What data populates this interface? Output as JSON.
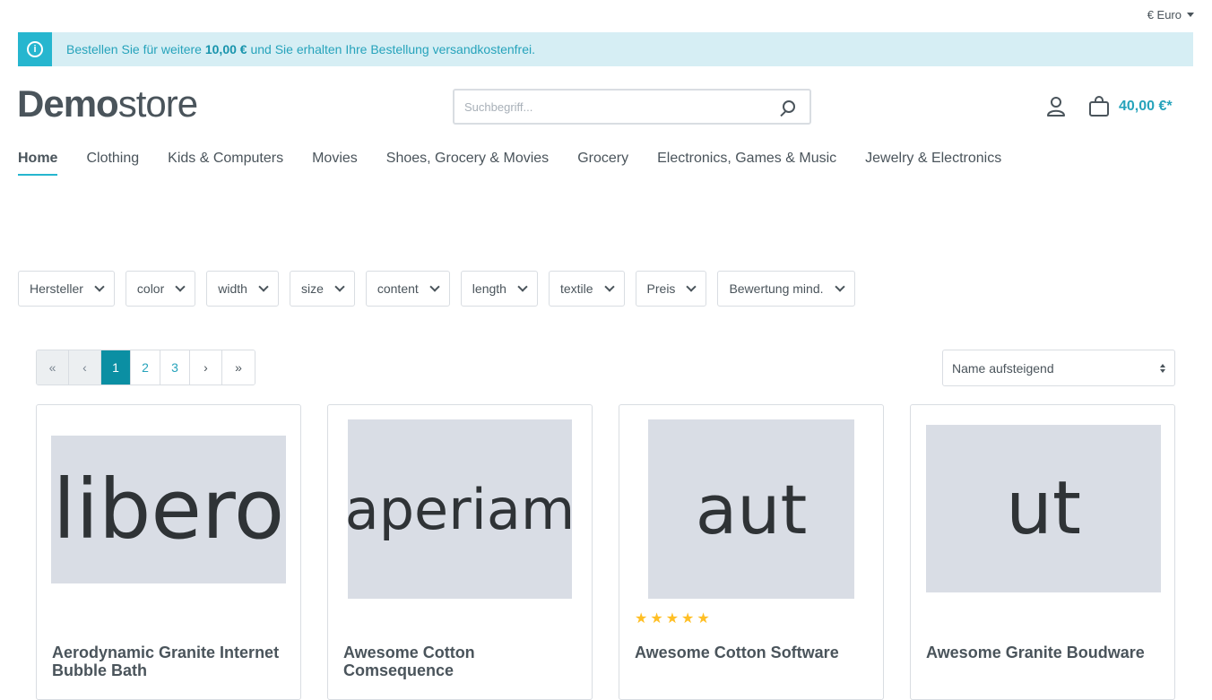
{
  "currency": {
    "label": "€ Euro"
  },
  "banner": {
    "text_before": "Bestellen Sie für weitere ",
    "amount": "10,00 €",
    "text_after": " und Sie erhalten Ihre Bestellung versandkostenfrei."
  },
  "header": {
    "logo_bold": "Demo",
    "logo_rest": "store",
    "search_placeholder": "Suchbegriff...",
    "cart_total": "40,00 €*"
  },
  "nav": {
    "items": [
      {
        "label": "Home"
      },
      {
        "label": "Clothing"
      },
      {
        "label": "Kids & Computers"
      },
      {
        "label": "Movies"
      },
      {
        "label": "Shoes, Grocery & Movies"
      },
      {
        "label": "Grocery"
      },
      {
        "label": "Electronics, Games & Music"
      },
      {
        "label": "Jewelry & Electronics"
      }
    ]
  },
  "filters": [
    {
      "label": "Hersteller"
    },
    {
      "label": "color"
    },
    {
      "label": "width"
    },
    {
      "label": "size"
    },
    {
      "label": "content"
    },
    {
      "label": "length"
    },
    {
      "label": "textile"
    },
    {
      "label": "Preis"
    },
    {
      "label": "Bewertung mind."
    }
  ],
  "pagination": {
    "first": "«",
    "prev": "‹",
    "pages": [
      "1",
      "2",
      "3"
    ],
    "current": "1",
    "next": "›",
    "last": "»"
  },
  "sort": {
    "selected": "Name aufsteigend"
  },
  "products": [
    {
      "image_text": "libero",
      "name": "Aerodynamic Granite Internet Bubble Bath",
      "rating": 0
    },
    {
      "image_text": "aperiam",
      "name": "Awesome Cotton Comsequence",
      "rating": 0
    },
    {
      "image_text": "aut",
      "name": "Awesome Cotton Software",
      "rating": 5
    },
    {
      "image_text": "ut",
      "name": "Awesome Granite Boudware",
      "rating": 0
    }
  ],
  "colors": {
    "accent": "#26b6cf",
    "accent_dark": "#0b8fa3",
    "banner_bg": "#d6eef4",
    "star": "#ffbf25"
  }
}
